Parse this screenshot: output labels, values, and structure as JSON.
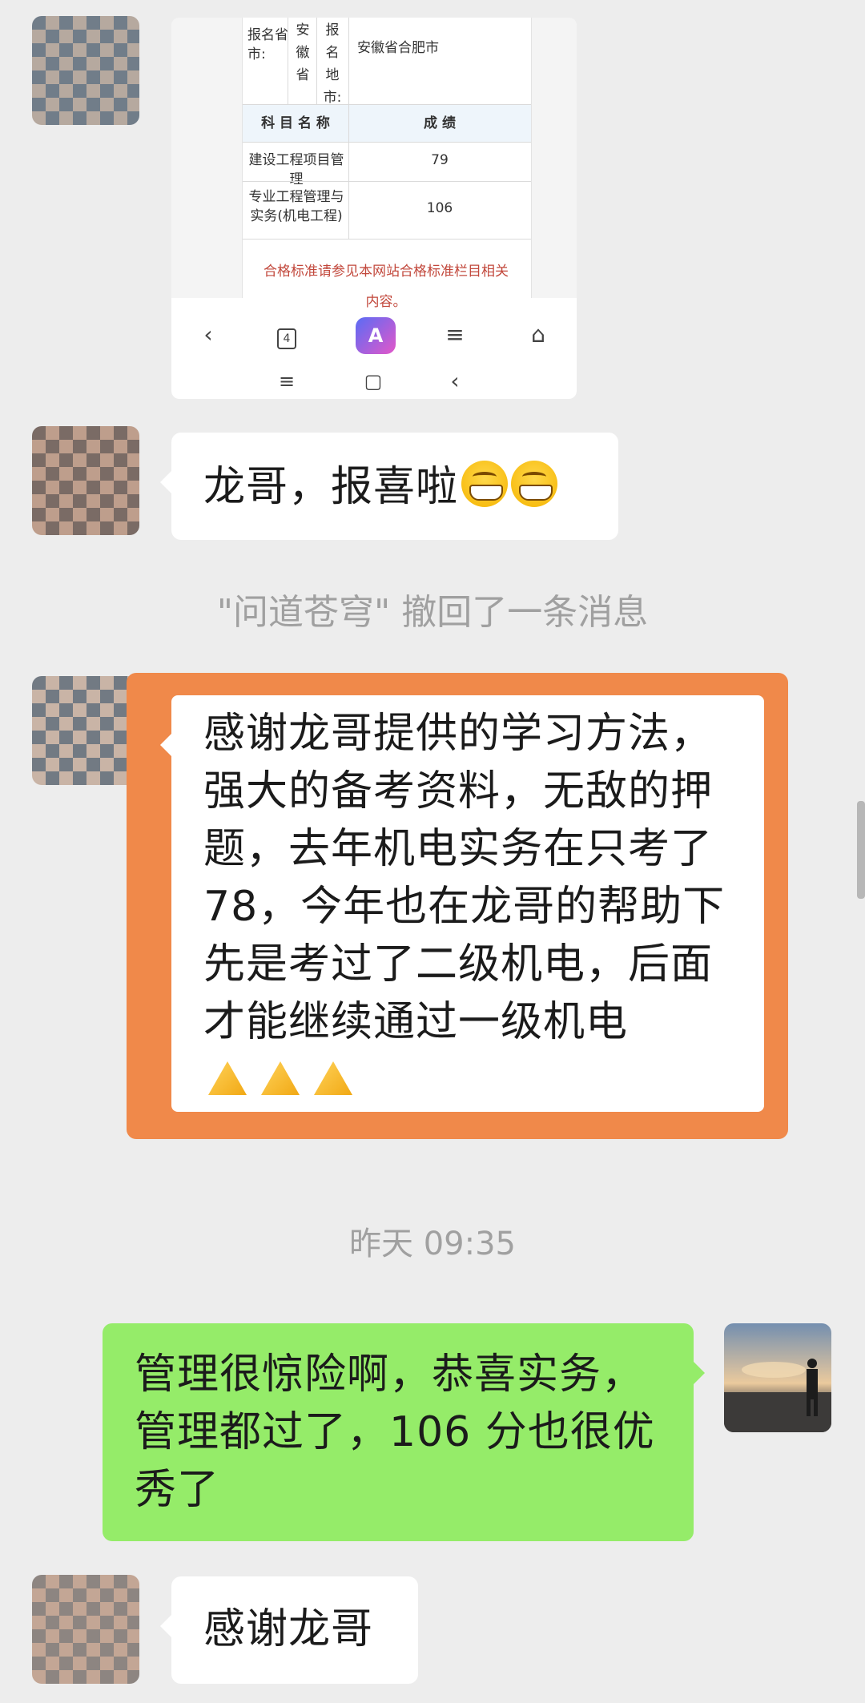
{
  "score_card": {
    "province_label": "报名省市:",
    "province_value": "安徽省",
    "city_label": "报名地市:",
    "city_value": "安徽省合肥市",
    "col_subject": "科 目 名 称",
    "col_score": "成 绩",
    "rows": [
      {
        "subject": "建设工程项目管理",
        "score": "79"
      },
      {
        "subject": "专业工程管理与实务(机电工程)",
        "score": "106"
      }
    ],
    "note": "合格标准请参见本网站合格标准栏目相关内容。",
    "tab_count": "4"
  },
  "messages": {
    "m1_text": "龙哥，报喜啦",
    "recall_notice": "\"问道苍穹\" 撤回了一条消息",
    "m2_text": "感谢龙哥提供的学习方法，强大的备考资料，无敌的押题，去年机电实务在只考了78，今年也在龙哥的帮助下先是考过了二级机电，后面才能继续通过一级机电",
    "timestamp": "昨天 09:35",
    "m3_text": "管理很惊险啊，恭喜实务，管理都过了，106 分也很优秀了",
    "m4_text": "感谢龙哥"
  },
  "colors": {
    "highlight_border": "#f0894a",
    "self_bubble": "#95ec69",
    "background": "#ededed"
  }
}
